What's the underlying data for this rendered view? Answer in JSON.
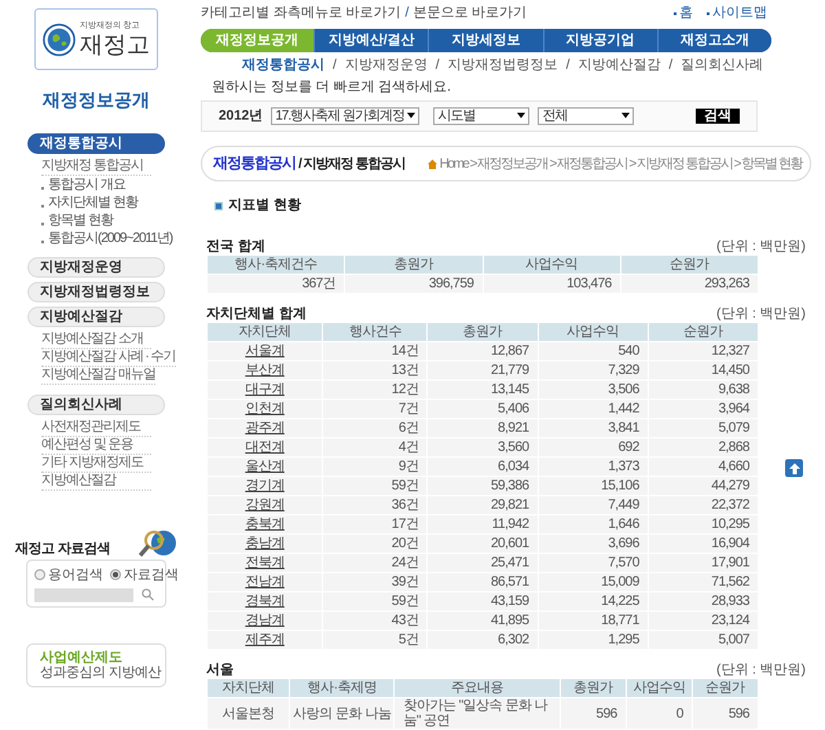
{
  "header": {
    "logo": {
      "tagline": "지방재정의 창고",
      "name": "재정고"
    },
    "top_links": [
      "카테고리별 좌측메뉴로 바로가기",
      "본문으로 바로가기"
    ],
    "top_link_separators": [
      "/"
    ],
    "util_links": [
      "홈",
      "사이트맵"
    ],
    "nav": [
      {
        "label": "재정정보공개",
        "selected": true
      },
      {
        "label": "지방예산/결산",
        "selected": false
      },
      {
        "label": "지방세정보",
        "selected": false
      },
      {
        "label": "지방공기업",
        "selected": false
      },
      {
        "label": "재정고소개",
        "selected": false
      }
    ],
    "sub_nav": [
      {
        "label": "재정통합공시",
        "selected": true
      },
      {
        "label": "지방재정운영",
        "selected": false
      },
      {
        "label": "지방재정법령정보",
        "selected": false
      },
      {
        "label": "지방예산절감",
        "selected": false
      },
      {
        "label": "질의회신사례",
        "selected": false
      }
    ],
    "sub_nav_separators": [
      "/",
      "/",
      "/",
      "/"
    ],
    "search_hint": "원하시는 정보를 더 빠르게 검색하세요.",
    "search": {
      "year": "2012년",
      "selects": [
        "17.행사축제 원가회계정",
        "시도별",
        "전체"
      ],
      "button": "검색"
    }
  },
  "sidebar": {
    "title": "재정정보공개",
    "sections": [
      {
        "label": "재정통합공시",
        "selected": true,
        "children": [
          {
            "label": "지방재정 통합공시",
            "children": [
              {
                "label": "통합공시 개요"
              },
              {
                "label": "자치단체별 현황"
              },
              {
                "label": "항목별 현황"
              },
              {
                "label": "통합공시(2009~2011년)"
              }
            ]
          }
        ]
      },
      {
        "label": "지방재정운영",
        "selected": false
      },
      {
        "label": "지방재정법령정보",
        "selected": false
      },
      {
        "label": "지방예산절감",
        "selected": false,
        "children": [
          {
            "label": "지방예산절감 소개"
          },
          {
            "label": "지방예산절감 사례 · 수기"
          },
          {
            "label": "지방예산절감 매뉴얼"
          }
        ]
      },
      {
        "label": "질의회신사례",
        "selected": false,
        "children": [
          {
            "label": "사전재정관리제도"
          },
          {
            "label": "예산편성 및 운용"
          },
          {
            "label": "기타 지방재정제도"
          },
          {
            "label": "지방예산절감"
          }
        ]
      }
    ],
    "data_search": {
      "title": "재정고 자료검색",
      "options": [
        {
          "label": "용어검색",
          "selected": false
        },
        {
          "label": "자료검색",
          "selected": true
        }
      ]
    },
    "banner": {
      "title": "사업예산제도",
      "subtitle": "성과중심의 지방예산"
    }
  },
  "main": {
    "title": "재정통합공시",
    "subtitle": "/ 지방재정 통합공시",
    "breadcrumb": "Home > 재정정보공개 > 재정통합공시 > 지방재정 통합공시 > 항목별 현황",
    "heading": "지표별 현황",
    "tables": [
      {
        "kind": "summary",
        "caption": "전국 합계",
        "unit": "(단위 : 백만원)",
        "first_column_links": false,
        "columns": [
          {
            "label": "행사·축제건수",
            "kind": "number"
          },
          {
            "label": "총원가",
            "kind": "number"
          },
          {
            "label": "사업수익",
            "kind": "number"
          },
          {
            "label": "순원가",
            "kind": "number"
          }
        ],
        "rows": [
          [
            "367건",
            "396,759",
            "103,476",
            "293,263"
          ]
        ]
      },
      {
        "kind": "by_region",
        "caption": "자치단체별 합계",
        "unit": "(단위 : 백만원)",
        "first_column_links": true,
        "columns": [
          {
            "label": "자치단체",
            "kind": "text"
          },
          {
            "label": "행사건수",
            "kind": "number"
          },
          {
            "label": "총원가",
            "kind": "number"
          },
          {
            "label": "사업수익",
            "kind": "number"
          },
          {
            "label": "순원가",
            "kind": "number"
          }
        ],
        "rows": [
          [
            "서울계",
            "14건",
            "12,867",
            "540",
            "12,327"
          ],
          [
            "부산계",
            "13건",
            "21,779",
            "7,329",
            "14,450"
          ],
          [
            "대구계",
            "12건",
            "13,145",
            "3,506",
            "9,638"
          ],
          [
            "인천계",
            "7건",
            "5,406",
            "1,442",
            "3,964"
          ],
          [
            "광주계",
            "6건",
            "8,921",
            "3,841",
            "5,079"
          ],
          [
            "대전계",
            "4건",
            "3,560",
            "692",
            "2,868"
          ],
          [
            "울산계",
            "9건",
            "6,034",
            "1,373",
            "4,660"
          ],
          [
            "경기계",
            "59건",
            "59,386",
            "15,106",
            "44,279"
          ],
          [
            "강원계",
            "36건",
            "29,821",
            "7,449",
            "22,372"
          ],
          [
            "충북계",
            "17건",
            "11,942",
            "1,646",
            "10,295"
          ],
          [
            "충남계",
            "20건",
            "20,601",
            "3,696",
            "16,904"
          ],
          [
            "전북계",
            "24건",
            "25,471",
            "7,570",
            "17,901"
          ],
          [
            "전남계",
            "39건",
            "86,571",
            "15,009",
            "71,562"
          ],
          [
            "경북계",
            "59건",
            "43,159",
            "14,225",
            "28,933"
          ],
          [
            "경남계",
            "43건",
            "41,895",
            "18,771",
            "23,124"
          ],
          [
            "제주계",
            "5건",
            "6,302",
            "1,295",
            "5,007"
          ]
        ]
      },
      {
        "kind": "detail",
        "caption": "서울",
        "unit": "(단위 : 백만원)",
        "first_column_links": false,
        "columns": [
          {
            "label": "자치단체",
            "kind": "text"
          },
          {
            "label": "행사·축제명",
            "kind": "text"
          },
          {
            "label": "주요내용",
            "kind": "left"
          },
          {
            "label": "총원가",
            "kind": "number"
          },
          {
            "label": "사업수익",
            "kind": "number"
          },
          {
            "label": "순원가",
            "kind": "number"
          }
        ],
        "rows": [
          [
            "서울본청",
            "사랑의 문화 나눔",
            "찾아가는 \"일상속 문화 나눔\" 공연",
            "596",
            "0",
            "596"
          ]
        ]
      }
    ]
  }
}
